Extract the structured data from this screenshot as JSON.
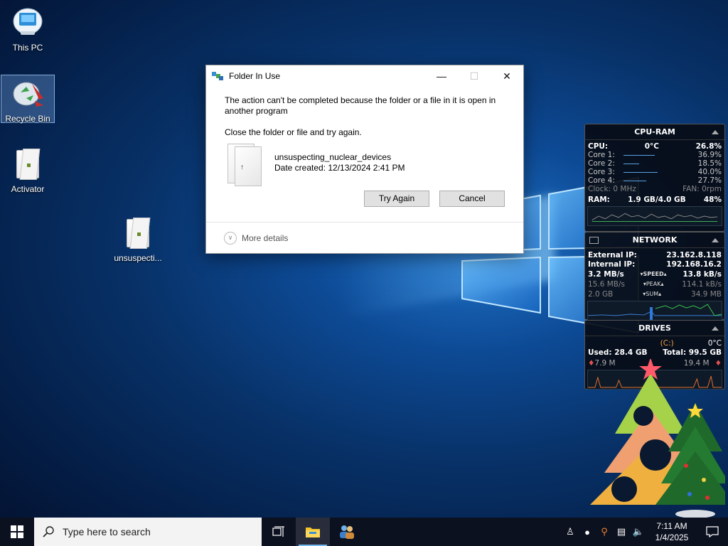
{
  "desktop": {
    "icons": [
      {
        "label": "This PC"
      },
      {
        "label": "Recycle Bin"
      },
      {
        "label": "Activator"
      },
      {
        "label": "unsuspecti..."
      }
    ]
  },
  "dialog": {
    "title": "Folder In Use",
    "message1": "The action can't be completed because the folder or a file in it is open in another program",
    "message2": "Close the folder or file and try again.",
    "file_name": "unsuspecting_nuclear_devices",
    "date_created": "Date created: 12/13/2024 2:41 PM",
    "try_again": "Try Again",
    "cancel": "Cancel",
    "more_details": "More details"
  },
  "cpu_ram": {
    "title": "CPU-RAM",
    "cpu_label": "CPU:",
    "temp": "0°C",
    "cpu_value": "26.8%",
    "cores": [
      {
        "label": "Core 1:",
        "value": "36.9%"
      },
      {
        "label": "Core 2:",
        "value": "18.5%"
      },
      {
        "label": "Core 3:",
        "value": "40.0%"
      },
      {
        "label": "Core 4:",
        "value": "27.7%"
      }
    ],
    "clock": "Clock: 0 MHz",
    "fan": "FAN: 0rpm",
    "ram_label": "RAM:",
    "ram_usage": "1.9 GB/4.0 GB",
    "ram_percent": "48%"
  },
  "network": {
    "title": "NETWORK",
    "external_label": "External IP:",
    "external_ip": "23.162.8.118",
    "internal_label": "Internal IP:",
    "internal_ip": "192.168.16.2",
    "rows": [
      {
        "left": "3.2 MB/s",
        "tag": "SPEED",
        "right": "13.8 kB/s"
      },
      {
        "left": "15.6 MB/s",
        "tag": "PEAK",
        "right": "114.1 kB/s"
      },
      {
        "left": "2.0 GB",
        "tag": "SUM",
        "right": "34.9 MB"
      }
    ]
  },
  "drives": {
    "title": "DRIVES",
    "drive": "(C:)",
    "temp": "0°C",
    "used": "Used: 28.4 GB",
    "total": "Total: 99.5 GB",
    "read": "7.9 M",
    "write": "19.4 M"
  },
  "taskbar": {
    "search_placeholder": "Type here to search",
    "time": "7:11 AM",
    "date": "1/4/2025"
  },
  "colors": {
    "accent": "#76b9ed",
    "taskbar": "#0c1120"
  }
}
